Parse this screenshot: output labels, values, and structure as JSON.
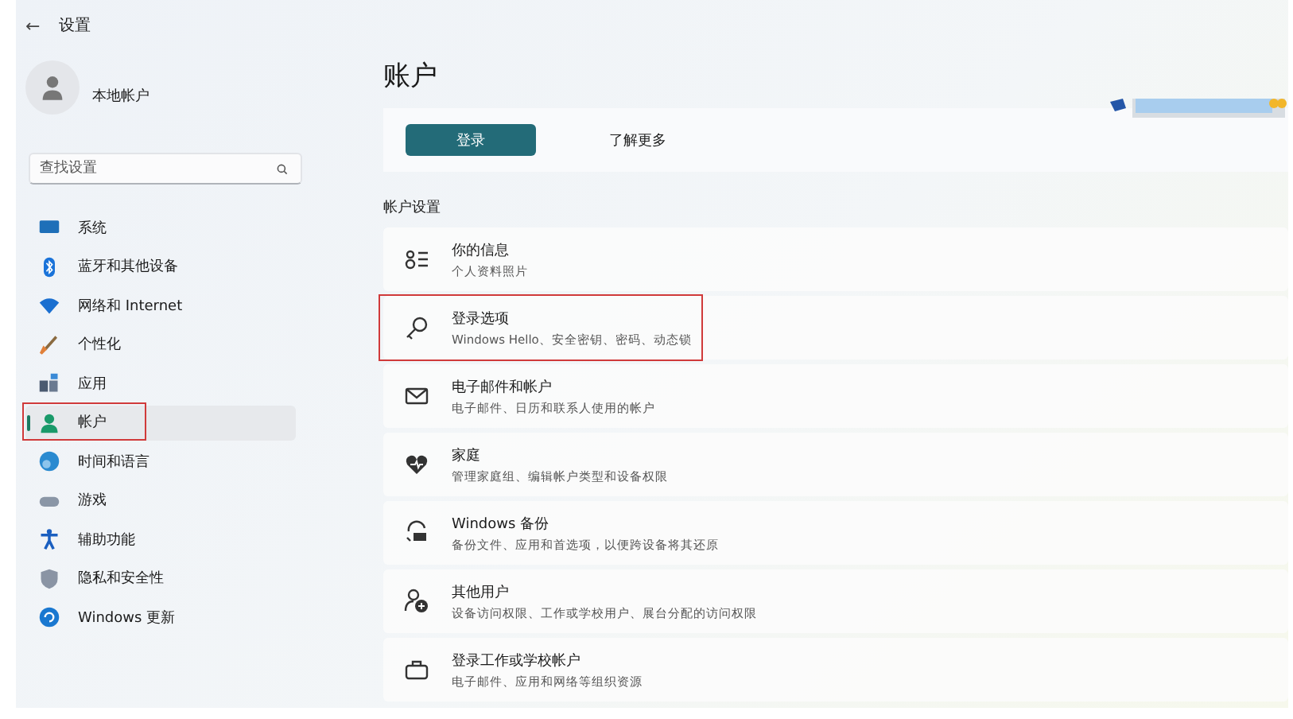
{
  "window": {
    "title": "设置",
    "back": "←"
  },
  "account": {
    "type": "本地帐户"
  },
  "search": {
    "placeholder": "查找设置"
  },
  "sidebar": {
    "items": [
      {
        "label": "系统",
        "selected": false,
        "highlighted": false
      },
      {
        "label": "蓝牙和其他设备",
        "selected": false,
        "highlighted": false
      },
      {
        "label": "网络和 Internet",
        "selected": false,
        "highlighted": false
      },
      {
        "label": "个性化",
        "selected": false,
        "highlighted": false
      },
      {
        "label": "应用",
        "selected": false,
        "highlighted": false
      },
      {
        "label": "帐户",
        "selected": true,
        "highlighted": true
      },
      {
        "label": "时间和语言",
        "selected": false,
        "highlighted": false
      },
      {
        "label": "游戏",
        "selected": false,
        "highlighted": false
      },
      {
        "label": "辅助功能",
        "selected": false,
        "highlighted": false
      },
      {
        "label": "隐私和安全性",
        "selected": false,
        "highlighted": false
      },
      {
        "label": "Windows 更新",
        "selected": false,
        "highlighted": false
      }
    ]
  },
  "page": {
    "title": "账户",
    "banner": {
      "primary_button": "登录",
      "link": "了解更多"
    },
    "section_title": "帐户设置",
    "rows": [
      {
        "title": "你的信息",
        "subtitle": "个人资料照片",
        "highlighted": false
      },
      {
        "title": "登录选项",
        "subtitle": "Windows Hello、安全密钥、密码、动态锁",
        "highlighted": true
      },
      {
        "title": "电子邮件和帐户",
        "subtitle": "电子邮件、日历和联系人使用的帐户",
        "highlighted": false
      },
      {
        "title": "家庭",
        "subtitle": "管理家庭组、编辑帐户类型和设备权限",
        "highlighted": false
      },
      {
        "title": "Windows 备份",
        "subtitle": "备份文件、应用和首选项，以便跨设备将其还原",
        "highlighted": false
      },
      {
        "title": "其他用户",
        "subtitle": "设备访问权限、工作或学校用户、展台分配的访问权限",
        "highlighted": false
      },
      {
        "title": "登录工作或学校帐户",
        "subtitle": "电子邮件、应用和网络等组织资源",
        "highlighted": false
      }
    ]
  }
}
